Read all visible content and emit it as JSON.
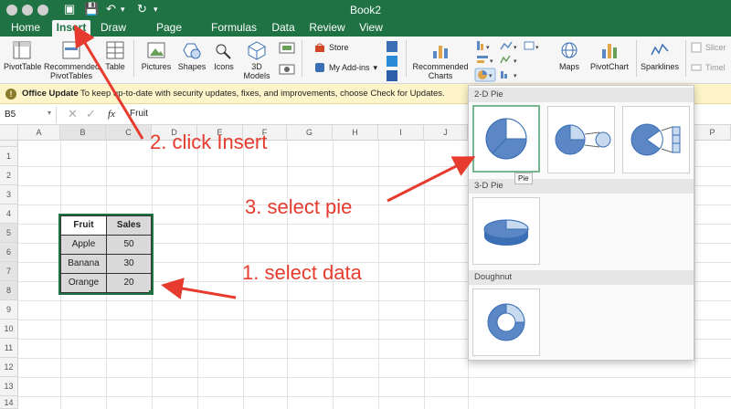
{
  "window": {
    "title": "Book2"
  },
  "tabs": [
    "Home",
    "Insert",
    "Draw",
    "Page Layout",
    "Formulas",
    "Data",
    "Review",
    "View"
  ],
  "active_tab": "Insert",
  "ribbon": {
    "pivottable": "PivotTable",
    "recommended_pivot_line1": "Recommended",
    "recommended_pivot_line2": "PivotTables",
    "table": "Table",
    "pictures": "Pictures",
    "shapes": "Shapes",
    "icons": "Icons",
    "models_line1": "3D",
    "models_line2": "Models",
    "store": "Store",
    "my_addins": "My Add-ins",
    "recommended_charts_line1": "Recommended",
    "recommended_charts_line2": "Charts",
    "maps": "Maps",
    "pivotchart": "PivotChart",
    "sparklines": "Sparklines",
    "slicer": "Slicer",
    "timeline": "Timel"
  },
  "notice": {
    "title": "Office Update",
    "message": "To keep up-to-date with security updates, fixes, and improvements, choose Check for Updates."
  },
  "formula_bar": {
    "name_box": "B5",
    "fx": "fx",
    "value": "Fruit"
  },
  "columns": [
    "A",
    "B",
    "C",
    "D",
    "E",
    "F",
    "G",
    "H",
    "I",
    "J",
    "P"
  ],
  "rows": [
    "1",
    "2",
    "3",
    "4",
    "5",
    "6",
    "7",
    "8",
    "9",
    "10",
    "11",
    "12",
    "13",
    "14"
  ],
  "table": {
    "headers": [
      "Fruit",
      "Sales"
    ],
    "rows": [
      [
        "Apple",
        "50"
      ],
      [
        "Banana",
        "30"
      ],
      [
        "Orange",
        "20"
      ]
    ]
  },
  "chart_menu": {
    "section_2d": "2-D Pie",
    "section_3d": "3-D Pie",
    "section_doughnut": "Doughnut",
    "tooltip": "Pie"
  },
  "annotations": {
    "step1": "1. select data",
    "step2": "2. click Insert",
    "step3": "3. select pie"
  },
  "colors": {
    "excel_green": "#1f7244",
    "annotation_red": "#e63b2e",
    "pie_blue": "#5b87c5",
    "pie_light": "#c7daf0"
  }
}
